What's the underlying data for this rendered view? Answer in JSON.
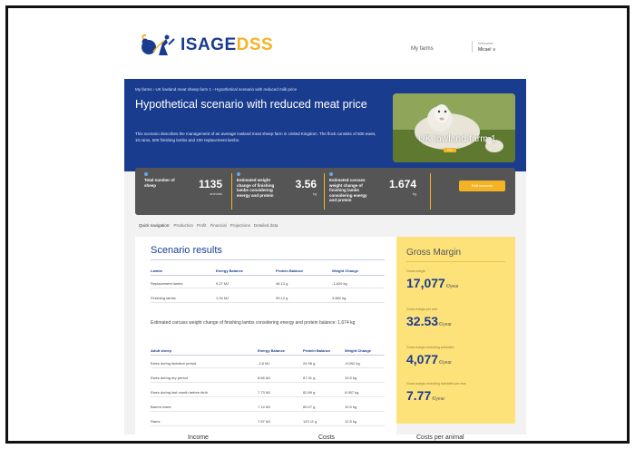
{
  "brand": {
    "name_part1": "ISAGE",
    "name_part2": "DSS",
    "blue": "#1a3c8f",
    "yellow": "#f4b324"
  },
  "header": {
    "my_farms": "My farms",
    "welcome": "Welcome",
    "user": "Micael ∨"
  },
  "breadcrumb": "My farms › UK lowland meat sheep farm 1 › Hypothetical scenario with reduced milk price",
  "page_title": "Hypothetical scenario with reduced meat price",
  "description": "This scenario describes the management of an average lowland meat sheep farm in United Kingdom. The flock consists of 500 ewes, 10 rams, 500 finishing lambs and 100 replacement lambs.",
  "farm_card": {
    "label": "UK lowland farm 1",
    "button": "View"
  },
  "stats": [
    {
      "label": "Total number of sheep",
      "value": "1135",
      "unit": "animals"
    },
    {
      "label": "Estimated weight change of finishing lambs considering energy and protein",
      "value": "3.56",
      "unit": "kg"
    },
    {
      "label": "Estimated carcass weight change of finishing lambs considering energy and protein",
      "value": "1.674",
      "unit": "kg"
    }
  ],
  "edit_button": "Edit scenario",
  "tabs": [
    "Quick navigation:",
    "Production",
    "Profit",
    "Financial",
    "Projections",
    "Detailed data"
  ],
  "results": {
    "title": "Scenario results",
    "lambs_header": [
      "Lambs",
      "Energy Balance",
      "Protein Balance",
      "Weight Change"
    ],
    "lambs_rows": [
      [
        "Replacement lambs",
        "9.27 MJ",
        "46.13 g",
        "-1.620 kg"
      ],
      [
        "Finishing lambs",
        "1.04 MJ",
        "39.12 g",
        "3.882 kg"
      ]
    ],
    "note": "Estimated carcass weight change of finishing lambs considering energy and protein balance: 1.674 kg",
    "adult_header": [
      "Adult sheep",
      "Energy Balance",
      "Protein Balance",
      "Weight Change"
    ],
    "adult_rows": [
      [
        "Ewes during lactation period",
        "-2.8 MJ",
        "24.98 g",
        "-8.092 kg"
      ],
      [
        "Ewes during dry period",
        "8.66 MJ",
        "87.31 g",
        "10.5 kg"
      ],
      [
        "Ewes during last month before birth",
        "7.73 MJ",
        "82.89 g",
        "6.087 kg"
      ],
      [
        "Barren ewes",
        "7.14 MJ",
        "89.07 g",
        "10.5 kg"
      ],
      [
        "Rams",
        "7.67 MJ",
        "120.11 g",
        "12.8 kg"
      ]
    ]
  },
  "gross_margin": {
    "title": "Gross Margin",
    "items": [
      {
        "label": "Gross margin",
        "value": "17,077",
        "unit": "€/year"
      },
      {
        "label": "Gross margin per ewe",
        "value": "32.53",
        "unit": "€/year"
      },
      {
        "label": "Gross margin excluding subsidies",
        "value": "4,077",
        "unit": "€/year"
      },
      {
        "label": "Gross margin excluding subsidies per ewe",
        "value": "7.77",
        "unit": "€/year"
      }
    ]
  },
  "bottom": [
    "Income",
    "Costs",
    "Costs per animal"
  ]
}
